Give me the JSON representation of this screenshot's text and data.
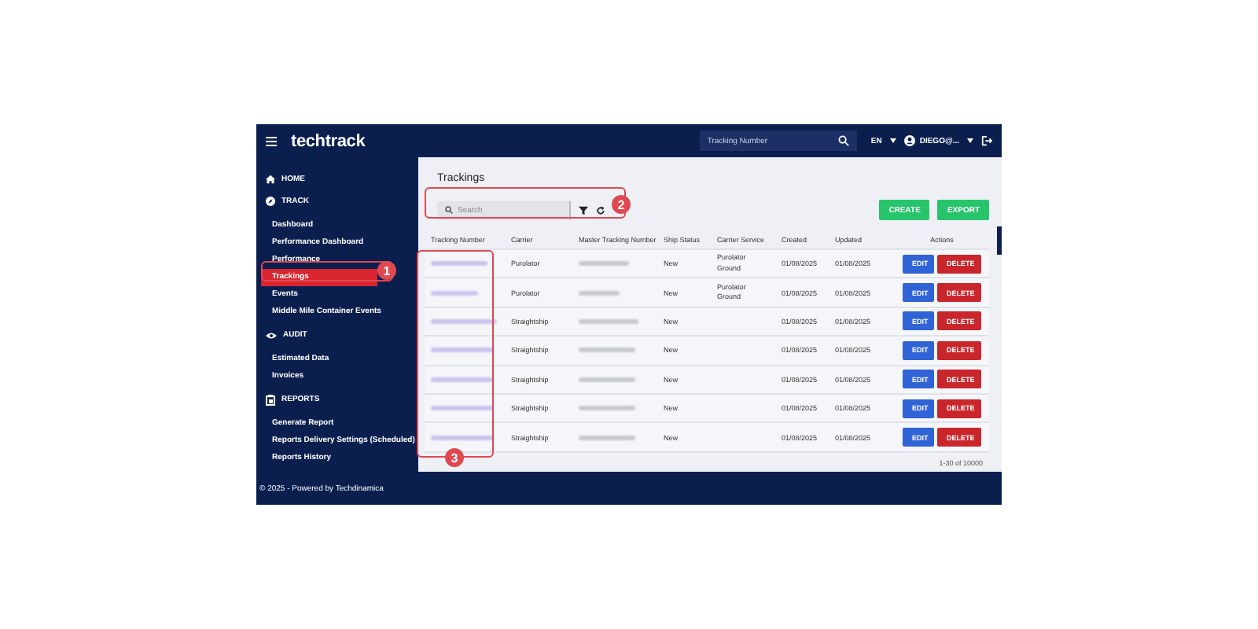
{
  "topbar": {
    "logo": "techtrack",
    "search": {
      "placeholder": "Tracking Number"
    },
    "language": "EN",
    "user": "DIEGO@..."
  },
  "sidebar": {
    "sections": [
      {
        "label": "HOME"
      },
      {
        "label": "TRACK",
        "items": [
          {
            "label": "Dashboard",
            "selected": false
          },
          {
            "label": "Performance Dashboard",
            "selected": false
          },
          {
            "label": "Performance",
            "selected": false
          },
          {
            "label": "Trackings",
            "selected": true
          },
          {
            "label": "Events",
            "selected": false
          },
          {
            "label": "Middle Mile Container Events",
            "selected": false
          }
        ]
      },
      {
        "label": "AUDIT",
        "items": [
          {
            "label": "Estimated Data",
            "selected": false
          },
          {
            "label": "Invoices",
            "selected": false
          }
        ]
      },
      {
        "label": "REPORTS",
        "items": [
          {
            "label": "Generate Report",
            "selected": false
          },
          {
            "label": "Reports Delivery Settings (Scheduled)",
            "selected": false
          },
          {
            "label": "Reports History",
            "selected": false
          }
        ]
      }
    ]
  },
  "page": {
    "title": "Trackings",
    "search": {
      "placeholder": "Search"
    },
    "buttons": [
      "CREATE",
      "EXPORT"
    ]
  },
  "table": {
    "columns": [
      "Tracking Number",
      "Carrier",
      "Master Tracking Number",
      "Ship Status",
      "Carrier Service",
      "Created",
      "Updated",
      "Actions"
    ],
    "rows": [
      {
        "carrier": "Purolator",
        "status": "New",
        "service": "Purolator Ground",
        "created": "01/08/2025",
        "updated": "01/08/2025",
        "actions": [
          "EDIT",
          "DELETE"
        ]
      },
      {
        "carrier": "Purolator",
        "status": "New",
        "service": "Purolator Ground",
        "created": "01/08/2025",
        "updated": "01/08/2025",
        "actions": [
          "EDIT",
          "DELETE"
        ]
      },
      {
        "carrier": "Straightship",
        "status": "New",
        "created": "01/08/2025",
        "updated": "01/08/2025",
        "actions": [
          "EDIT",
          "DELETE"
        ]
      },
      {
        "carrier": "Straightship",
        "status": "New",
        "created": "01/08/2025",
        "updated": "01/08/2025",
        "actions": [
          "EDIT",
          "DELETE"
        ]
      },
      {
        "carrier": "Straightship",
        "status": "New",
        "created": "01/08/2025",
        "updated": "01/08/2025",
        "actions": [
          "EDIT",
          "DELETE"
        ]
      },
      {
        "carrier": "Straightship",
        "status": "New",
        "created": "01/08/2025",
        "updated": "01/08/2025",
        "actions": [
          "EDIT",
          "DELETE"
        ]
      },
      {
        "carrier": "Straightship",
        "status": "New",
        "created": "01/08/2025",
        "updated": "01/08/2025",
        "actions": [
          "EDIT",
          "DELETE"
        ]
      }
    ],
    "pagination": "1-30 of 10000"
  },
  "footer": "© 2025 - Powered by Techdinamica",
  "annotations": [
    {
      "label": "1"
    },
    {
      "label": "2"
    },
    {
      "label": "3"
    }
  ]
}
